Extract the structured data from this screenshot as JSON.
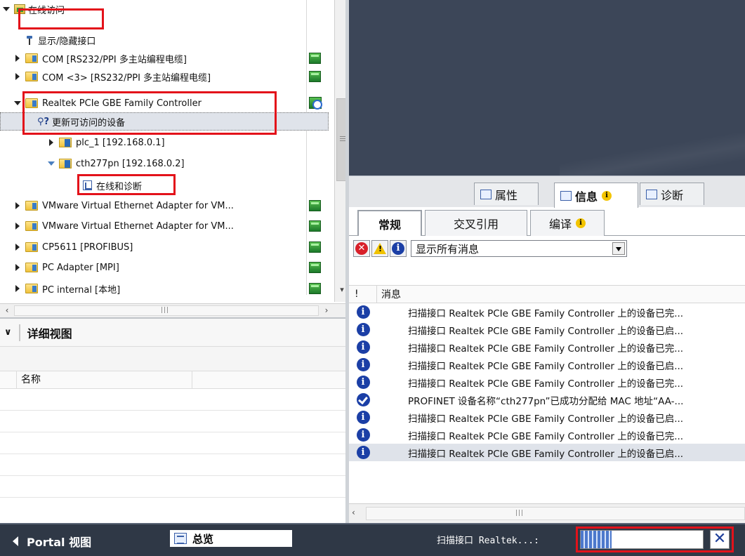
{
  "tree": {
    "root_label": "在线访问",
    "items": [
      {
        "label": "显示/隐藏接口"
      },
      {
        "label": "COM [RS232/PPI 多主站编程电缆]"
      },
      {
        "label": "COM <3> [RS232/PPI 多主站编程电缆]"
      },
      {
        "label": "Realtek PCIe GBE Family Controller"
      },
      {
        "label": "更新可访问的设备"
      },
      {
        "label": "plc_1 [192.168.0.1]"
      },
      {
        "label": "cth277pn [192.168.0.2]"
      },
      {
        "label": "在线和诊断"
      },
      {
        "label": "VMware Virtual Ethernet Adapter for VM..."
      },
      {
        "label": "VMware Virtual Ethernet Adapter for VM..."
      },
      {
        "label": "CP5611 [PROFIBUS]"
      },
      {
        "label": "PC Adapter [MPI]"
      },
      {
        "label": "PC internal [本地]"
      }
    ]
  },
  "detail_view": {
    "title": "详细视图",
    "column_name": "名称"
  },
  "inspector": {
    "tabs": [
      {
        "label": "属性"
      },
      {
        "label": "信息"
      },
      {
        "label": "诊断"
      }
    ],
    "info_badge": "i",
    "sub_tabs": [
      {
        "label": "常规"
      },
      {
        "label": "交叉引用"
      },
      {
        "label": "编译"
      }
    ],
    "filter_error_symbol": "✕",
    "filter_info_symbol": "i",
    "filter_value": "显示所有消息",
    "columns": {
      "flag": "!",
      "message": "消息"
    },
    "messages": [
      {
        "icon": "info",
        "text": "扫描接口 Realtek PCIe GBE Family Controller 上的设备已完..."
      },
      {
        "icon": "info",
        "text": "扫描接口 Realtek PCIe GBE Family Controller 上的设备已启..."
      },
      {
        "icon": "info",
        "text": "扫描接口 Realtek PCIe GBE Family Controller 上的设备已完..."
      },
      {
        "icon": "info",
        "text": "扫描接口 Realtek PCIe GBE Family Controller 上的设备已启..."
      },
      {
        "icon": "info",
        "text": "扫描接口 Realtek PCIe GBE Family Controller 上的设备已完..."
      },
      {
        "icon": "success",
        "text": "PROFINET 设备名称“cth277pn”已成功分配给 MAC 地址“AA-..."
      },
      {
        "icon": "info",
        "text": "扫描接口 Realtek PCIe GBE Family Controller 上的设备已启..."
      },
      {
        "icon": "info",
        "text": "扫描接口 Realtek PCIe GBE Family Controller 上的设备已完..."
      },
      {
        "icon": "info",
        "text": "扫描接口 Realtek PCIe GBE Family Controller 上的设备已启..."
      }
    ]
  },
  "statusbar": {
    "portal_label": "Portal 视图",
    "overview_label": "总览",
    "status_text": "扫描接口 Realtek...:",
    "cancel_symbol": "✕",
    "progress_fraction": 0.25
  },
  "colors": {
    "accent_red_highlight": "#e3121a",
    "info_blue": "#1b3fa6",
    "statusbar_bg": "#2f3846",
    "workspace_bg": "#3c4658"
  }
}
